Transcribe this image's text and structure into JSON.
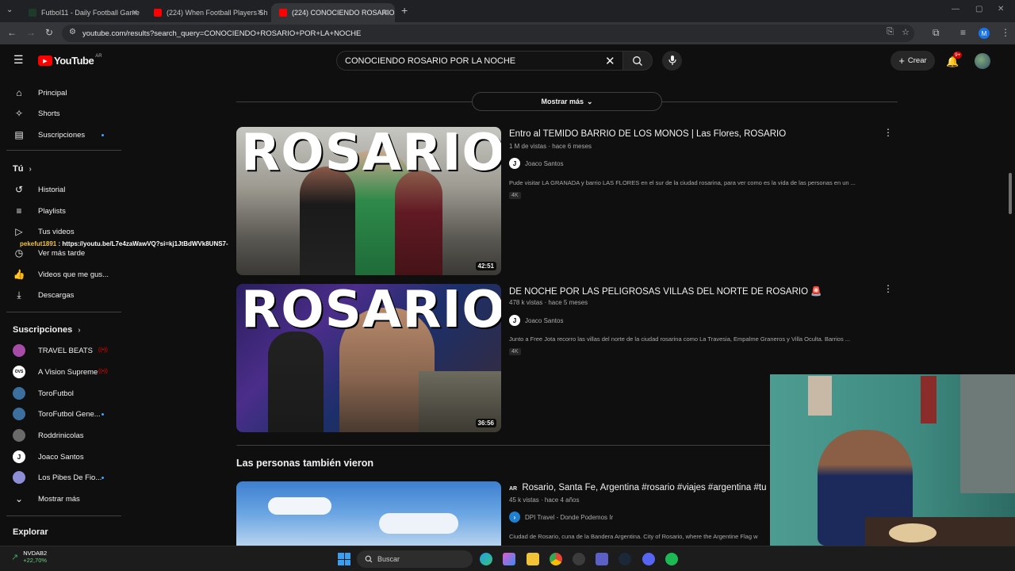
{
  "browser": {
    "tabs": [
      {
        "label": "Futbol11 - Daily Football Game",
        "color": "#1e3a2a"
      },
      {
        "label": "(224) When Football Players Sh",
        "color": "#ff0000"
      },
      {
        "label": "(224) CONOCIENDO ROSARIO",
        "color": "#ff0000"
      }
    ],
    "url": "youtube.com/results?search_query=CONOCIENDO+ROSARIO+POR+LA+NOCHE",
    "profile_initial": "M"
  },
  "header": {
    "logo": "YouTube",
    "region": "AR",
    "search_value": "CONOCIENDO ROSARIO POR LA NOCHE",
    "create_label": "Crear",
    "notif_count": "9+"
  },
  "sidebar": {
    "main_items": [
      {
        "label": "Principal",
        "icon": "home-icon"
      },
      {
        "label": "Shorts",
        "icon": "shorts-icon"
      },
      {
        "label": "Suscripciones",
        "icon": "subscriptions-icon"
      }
    ],
    "you_heading": "Tú",
    "you_items": [
      {
        "label": "Historial",
        "icon": "history-icon"
      },
      {
        "label": "Playlists",
        "icon": "playlists-icon"
      },
      {
        "label": "Tus videos",
        "icon": "your-videos-icon"
      },
      {
        "label": "Ver más tarde",
        "icon": "watch-later-icon"
      },
      {
        "label": "Videos que me gus...",
        "icon": "like-icon"
      },
      {
        "label": "Descargas",
        "icon": "download-icon"
      }
    ],
    "subs_heading": "Suscripciones",
    "subs": [
      {
        "label": "TRAVEL BEATS",
        "color": "#a64ca6"
      },
      {
        "label": "A Vision Supreme",
        "color": "#ffffff"
      },
      {
        "label": "ToroFutbol",
        "color": "#3d6f9e"
      },
      {
        "label": "ToroFutbol Gene...",
        "color": "#3d6f9e"
      },
      {
        "label": "Roddrinicolas",
        "color": "#6a6a6a"
      },
      {
        "label": "Joaco Santos",
        "color": "#ffffff"
      },
      {
        "label": "Los Pibes De Fio...",
        "color": "#8e8ed6"
      }
    ],
    "show_more": "Mostrar más",
    "explore": "Explorar"
  },
  "overlay_chat": {
    "user": "pekefut1891",
    "message": ": https://youtu.be/L7e4zaWawVQ?si=kj1JtBdWVk8UNS7-"
  },
  "main": {
    "show_more_label": "Mostrar más",
    "videos": [
      {
        "title": "Entro al TEMIDO BARRIO DE LOS MONOS | Las Flores, ROSARIO",
        "meta": "1 M de vistas · hace 6 meses",
        "channel": "Joaco Santos",
        "description": "Pude visitar LA GRANADA y barrio LAS FLORES en el sur de la ciudad rosarina, para ver como es la vida de las personas en un ...",
        "badge": "4K",
        "duration": "42:51",
        "thumb_text": "ROSARIO"
      },
      {
        "title": "DE NOCHE POR LAS PELIGROSAS VILLAS DEL NORTE DE ROSARIO 🚨",
        "meta": "478 k vistas · hace 5 meses",
        "channel": "Joaco Santos",
        "description": "Junto a Free Jota recorro las villas del norte de la ciudad rosarina como La Travesia, Empalme Graneros y Villa Oculta. Barrios ...",
        "badge": "4K",
        "duration": "36:56",
        "thumb_text": "ROSARIO"
      }
    ],
    "section_heading": "Las personas también vieron",
    "related": {
      "title": "Rosario, Santa Fe, Argentina #rosario #viajes #argentina #tu",
      "flag": "AR",
      "meta": "45 k vistas · hace 4 años",
      "channel": "DPI Travel - Donde Podemos Ir",
      "description": "Ciudad de Rosario, cuna de la Bandera Argentina. City of Rosario, where the Argentine Flag w"
    }
  },
  "taskbar": {
    "stock_name": "NVDAB2",
    "stock_change": "+22,70%",
    "search_placeholder": "Buscar"
  }
}
